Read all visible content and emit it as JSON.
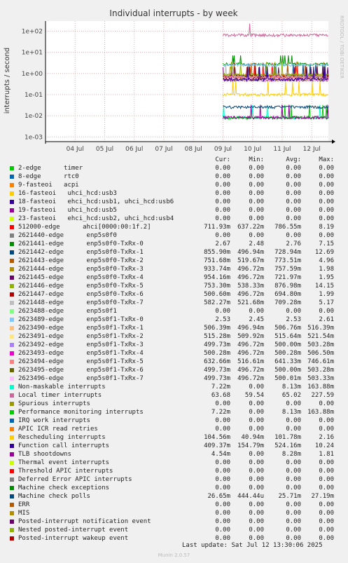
{
  "chart_data": {
    "type": "line",
    "title": "Individual interrupts - by week",
    "ylabel": "interrupts / second",
    "yscale": "log",
    "ylim": [
      0.0006,
      300
    ],
    "y_tick_labels": [
      "1e+02",
      "1e+01",
      "1e+00",
      "1e-01",
      "1e-02",
      "1e-03"
    ],
    "x_tick_labels": [
      "04 Jul",
      "05 Jul",
      "06 Jul",
      "07 Jul",
      "08 Jul",
      "09 Jul",
      "10 Jul",
      "11 Jul",
      "12 Jul"
    ],
    "xlim": [
      "2025-07-03",
      "2025-07-12 13:30"
    ],
    "data_start": "2025-07-09",
    "grid": true,
    "side_label": "RRDTOOL / TOBI OETIKER",
    "series": [
      {
        "name": "2-edge      timer",
        "color": "#00cc00",
        "cur": "0.00",
        "min": "0.00",
        "avg": "0.00",
        "max": "0.00"
      },
      {
        "name": "8-edge      rtc0",
        "color": "#0066b3",
        "cur": "0.00",
        "min": "0.00",
        "avg": "0.00",
        "max": "0.00"
      },
      {
        "name": "9-fasteoi   acpi",
        "color": "#ff8000",
        "cur": "0.00",
        "min": "0.00",
        "avg": "0.00",
        "max": "0.00"
      },
      {
        "name": "16-fasteoi   uhci_hcd:usb3",
        "color": "#ffcc00",
        "cur": "0.00",
        "min": "0.00",
        "avg": "0.00",
        "max": "0.00"
      },
      {
        "name": "18-fasteoi   ehci_hcd:usb1, uhci_hcd:usb6",
        "color": "#330099",
        "cur": "0.00",
        "min": "0.00",
        "avg": "0.00",
        "max": "0.00"
      },
      {
        "name": "19-fasteoi   uhci_hcd:usb5",
        "color": "#990099",
        "cur": "0.00",
        "min": "0.00",
        "avg": "0.00",
        "max": "0.00"
      },
      {
        "name": "23-fasteoi   ehci_hcd:usb2, uhci_hcd:usb4",
        "color": "#ccff00",
        "cur": "0.00",
        "min": "0.00",
        "avg": "0.00",
        "max": "0.00"
      },
      {
        "name": "512000-edge      ahci[0000:00:1f.2]",
        "color": "#ff0000",
        "cur": "711.93m",
        "min": "637.22m",
        "avg": "786.55m",
        "max": "8.19"
      },
      {
        "name": "2621440-edge      enp5s0f0",
        "color": "#808080",
        "cur": "0.00",
        "min": "0.00",
        "avg": "0.00",
        "max": "0.00"
      },
      {
        "name": "2621441-edge      enp5s0f0-TxRx-0",
        "color": "#008f00",
        "cur": "2.67",
        "min": "2.48",
        "avg": "2.76",
        "max": "7.15"
      },
      {
        "name": "2621442-edge      enp5s0f0-TxRx-1",
        "color": "#00487d",
        "cur": "855.90m",
        "min": "496.94m",
        "avg": "728.94m",
        "max": "12.69"
      },
      {
        "name": "2621443-edge      enp5s0f0-TxRx-2",
        "color": "#b35a00",
        "cur": "751.68m",
        "min": "519.67m",
        "avg": "773.51m",
        "max": "4.96"
      },
      {
        "name": "2621444-edge      enp5s0f0-TxRx-3",
        "color": "#b38f00",
        "cur": "933.74m",
        "min": "496.72m",
        "avg": "757.59m",
        "max": "1.98"
      },
      {
        "name": "2621445-edge      enp5s0f0-TxRx-4",
        "color": "#6b006b",
        "cur": "954.16m",
        "min": "496.72m",
        "avg": "721.97m",
        "max": "1.95"
      },
      {
        "name": "2621446-edge      enp5s0f0-TxRx-5",
        "color": "#8fb300",
        "cur": "753.30m",
        "min": "538.33m",
        "avg": "876.98m",
        "max": "14.15"
      },
      {
        "name": "2621447-edge      enp5s0f0-TxRx-6",
        "color": "#b30000",
        "cur": "500.60m",
        "min": "496.72m",
        "avg": "694.80m",
        "max": "1.99"
      },
      {
        "name": "2621448-edge      enp5s0f0-TxRx-7",
        "color": "#bebebe",
        "cur": "582.27m",
        "min": "521.68m",
        "avg": "709.28m",
        "max": "5.17"
      },
      {
        "name": "2623488-edge      enp5s0f1",
        "color": "#80ff80",
        "cur": "0.00",
        "min": "0.00",
        "avg": "0.00",
        "max": "0.00"
      },
      {
        "name": "2623489-edge      enp5s0f1-TxRx-0",
        "color": "#80c9ff",
        "cur": "2.53",
        "min": "2.45",
        "avg": "2.53",
        "max": "2.61"
      },
      {
        "name": "2623490-edge      enp5s0f1-TxRx-1",
        "color": "#ffc080",
        "cur": "506.39m",
        "min": "496.94m",
        "avg": "506.76m",
        "max": "516.39m"
      },
      {
        "name": "2623491-edge      enp5s0f1-TxRx-2",
        "color": "#ffe680",
        "cur": "515.28m",
        "min": "509.92m",
        "avg": "515.64m",
        "max": "521.54m"
      },
      {
        "name": "2623492-edge      enp5s0f1-TxRx-3",
        "color": "#aa80ff",
        "cur": "499.73m",
        "min": "496.72m",
        "avg": "500.00m",
        "max": "503.28m"
      },
      {
        "name": "2623493-edge      enp5s0f1-TxRx-4",
        "color": "#ee00cc",
        "cur": "500.28m",
        "min": "496.72m",
        "avg": "500.28m",
        "max": "506.50m"
      },
      {
        "name": "2623494-edge      enp5s0f1-TxRx-5",
        "color": "#ff8080",
        "cur": "632.66m",
        "min": "516.61m",
        "avg": "641.33m",
        "max": "746.61m"
      },
      {
        "name": "2623495-edge      enp5s0f1-TxRx-6",
        "color": "#666600",
        "cur": "499.73m",
        "min": "496.72m",
        "avg": "500.00m",
        "max": "503.28m"
      },
      {
        "name": "2623496-edge      enp5s0f1-TxRx-7",
        "color": "#ffbfff",
        "cur": "499.73m",
        "min": "496.72m",
        "avg": "500.01m",
        "max": "503.33m"
      },
      {
        "name": "Non-maskable interrupts",
        "color": "#00ffcc",
        "cur": "7.22m",
        "min": "0.00",
        "avg": "8.13m",
        "max": "163.88m"
      },
      {
        "name": "Local timer interrupts",
        "color": "#cc6699",
        "cur": "63.68",
        "min": "59.54",
        "avg": "65.02",
        "max": "227.59"
      },
      {
        "name": "Spurious interrupts",
        "color": "#999900",
        "cur": "0.00",
        "min": "0.00",
        "avg": "0.00",
        "max": "0.00"
      },
      {
        "name": "Performance monitoring interrupts",
        "color": "#00cc00",
        "cur": "7.22m",
        "min": "0.00",
        "avg": "8.13m",
        "max": "163.88m"
      },
      {
        "name": "IRQ work interrupts",
        "color": "#0066b3",
        "cur": "0.00",
        "min": "0.00",
        "avg": "0.00",
        "max": "0.00"
      },
      {
        "name": "APIC ICR read retries",
        "color": "#ff8000",
        "cur": "0.00",
        "min": "0.00",
        "avg": "0.00",
        "max": "0.00"
      },
      {
        "name": "Rescheduling interrupts",
        "color": "#ffcc00",
        "cur": "104.56m",
        "min": "40.94m",
        "avg": "101.78m",
        "max": "2.16"
      },
      {
        "name": "Function call interrupts",
        "color": "#330099",
        "cur": "409.37m",
        "min": "154.79m",
        "avg": "524.16m",
        "max": "10.24"
      },
      {
        "name": "TLB shootdowns",
        "color": "#990099",
        "cur": "4.54m",
        "min": "0.00",
        "avg": "8.28m",
        "max": "1.81"
      },
      {
        "name": "Thermal event interrupts",
        "color": "#ccff00",
        "cur": "0.00",
        "min": "0.00",
        "avg": "0.00",
        "max": "0.00"
      },
      {
        "name": "Threshold APIC interrupts",
        "color": "#ff0000",
        "cur": "0.00",
        "min": "0.00",
        "avg": "0.00",
        "max": "0.00"
      },
      {
        "name": "Deferred Error APIC interrupts",
        "color": "#808080",
        "cur": "0.00",
        "min": "0.00",
        "avg": "0.00",
        "max": "0.00"
      },
      {
        "name": "Machine check exceptions",
        "color": "#008f00",
        "cur": "0.00",
        "min": "0.00",
        "avg": "0.00",
        "max": "0.00"
      },
      {
        "name": "Machine check polls",
        "color": "#00487d",
        "cur": "26.65m",
        "min": "444.44u",
        "avg": "25.71m",
        "max": "27.19m"
      },
      {
        "name": "ERR",
        "color": "#b35a00",
        "cur": "0.00",
        "min": "0.00",
        "avg": "0.00",
        "max": "0.00"
      },
      {
        "name": "MIS",
        "color": "#b38f00",
        "cur": "0.00",
        "min": "0.00",
        "avg": "0.00",
        "max": "0.00"
      },
      {
        "name": "Posted-interrupt notification event",
        "color": "#6b006b",
        "cur": "0.00",
        "min": "0.00",
        "avg": "0.00",
        "max": "0.00"
      },
      {
        "name": "Nested posted-interrupt event",
        "color": "#8fb300",
        "cur": "0.00",
        "min": "0.00",
        "avg": "0.00",
        "max": "0.00"
      },
      {
        "name": "Posted-interrupt wakeup event",
        "color": "#b30000",
        "cur": "0.00",
        "min": "0.00",
        "avg": "0.00",
        "max": "0.00"
      }
    ]
  },
  "legend": {
    "cur": "Cur:",
    "min": "Min:",
    "avg": "Avg:",
    "max": "Max:"
  },
  "last_update": "Last update: Sat Jul 12 13:30:06 2025",
  "version": "Munin 2.0.57"
}
